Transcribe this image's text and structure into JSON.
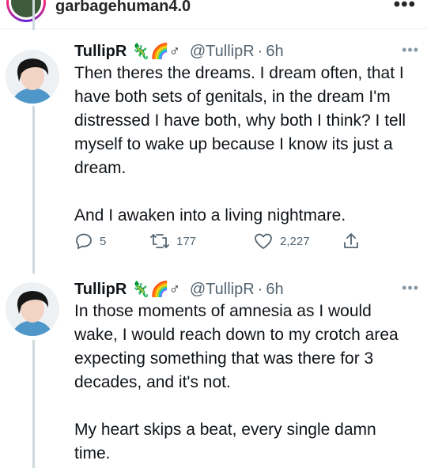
{
  "header": {
    "username": "garbagehuman4.0",
    "more_icon": "ellipsis-icon"
  },
  "tweets": [
    {
      "name": "TullipR",
      "emoji": "🦎🌈♂",
      "handle": "@TullipR",
      "separator": "·",
      "time": "6h",
      "paragraphs": [
        "Then theres the dreams. I dream often, that I have both sets of genitals, in the dream I'm distressed I have both, why both I think? I tell myself to wake up because I know its just a dream.",
        "And I awaken into a living nightmare."
      ],
      "replies": "5",
      "retweets": "177",
      "likes": "2,227"
    },
    {
      "name": "TullipR",
      "emoji": "🦎🌈♂",
      "handle": "@TullipR",
      "separator": "·",
      "time": "6h",
      "paragraphs": [
        "In those moments of amnesia as I would wake, I would reach down to my crotch area expecting something that was there for 3 decades, and it's not.",
        "My heart skips a beat, every single damn time."
      ]
    }
  ],
  "colors": {
    "text": "#0f1419",
    "secondary": "#536471",
    "thread_line": "#cfd9de"
  }
}
